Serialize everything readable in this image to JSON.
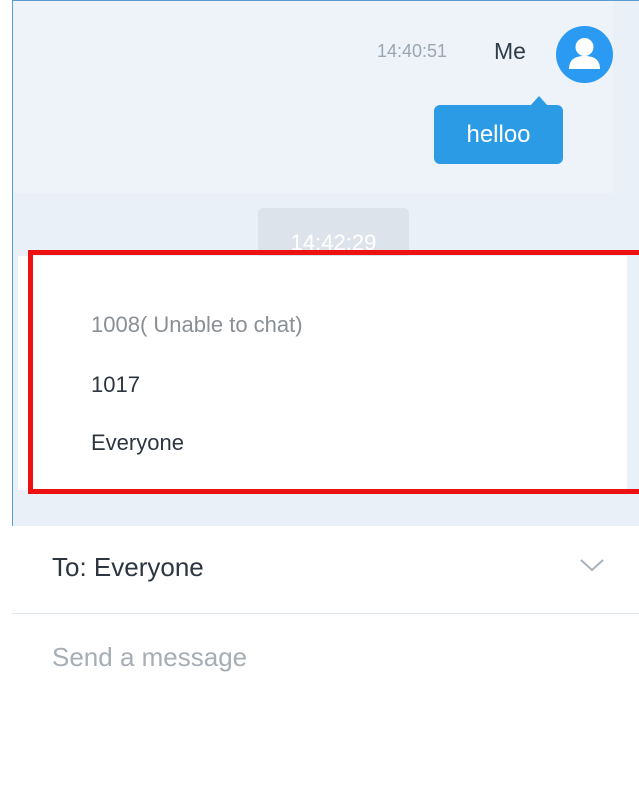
{
  "messages": [
    {
      "time": "14:40:51",
      "sender": "Me",
      "text": "helloo",
      "avatar_icon": "user-avatar-icon"
    }
  ],
  "time_divider": "14:42:29",
  "recipient_dropdown": {
    "options": [
      {
        "label": "1008( Unable to chat)",
        "disabled": true
      },
      {
        "label": "1017",
        "disabled": false
      },
      {
        "label": "Everyone",
        "disabled": false
      }
    ]
  },
  "recipient_select": {
    "label": "To: Everyone",
    "icon": "chevron-down-icon"
  },
  "compose": {
    "placeholder": "Send a message"
  },
  "colors": {
    "accent": "#2b9be6",
    "highlight": "#ee1111"
  }
}
